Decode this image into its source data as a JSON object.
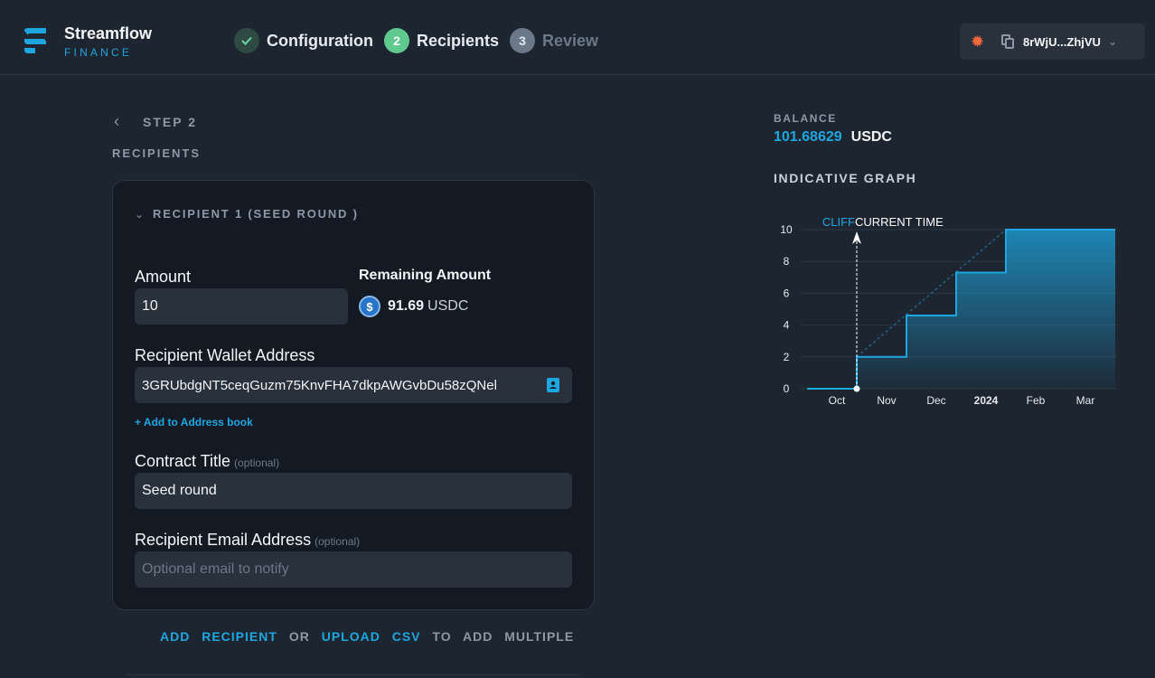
{
  "app": {
    "name": "Streamflow",
    "sub": "FINANCE"
  },
  "steps": [
    {
      "num": "",
      "label": "Configuration",
      "state": "done"
    },
    {
      "num": "2",
      "label": "Recipients",
      "state": "active"
    },
    {
      "num": "3",
      "label": "Review",
      "state": "todo"
    }
  ],
  "wallet": {
    "address": "8rWjU...ZhjVU",
    "icon": "burst-icon",
    "copy_icon": "copy-icon",
    "chevron": "chevron-down-icon"
  },
  "nav": {
    "back_label": "STEP 2",
    "section_title": "RECIPIENTS"
  },
  "recipient": {
    "header": "RECIPIENT 1 (SEED ROUND )",
    "amount_label": "Amount",
    "amount_value": "10",
    "remaining_label": "Remaining Amount",
    "remaining_value": "91.69",
    "remaining_unit": "USDC",
    "coin_glyph": "$",
    "wallet_label": "Recipient Wallet Address",
    "wallet_value": "3GRUbdgNT5ceqGuzm75KnvFHA7dkpAWGvbDu58zQNel",
    "add_address_book": "+ Add to Address book",
    "title_label": "Contract Title",
    "title_optional": "(optional)",
    "title_value": "Seed round",
    "email_label": "Recipient Email Address",
    "email_optional": "(optional)",
    "email_placeholder": "Optional email to notify"
  },
  "footer": {
    "add": "ADD",
    "recipient": "RECIPIENT",
    "or": "OR",
    "upload": "UPLOAD",
    "csv": "CSV",
    "to": "TO",
    "add2": "ADD",
    "multiple": "MULTIPLE"
  },
  "balance": {
    "label": "BALANCE",
    "value": "101.68629",
    "unit": "USDC"
  },
  "colors": {
    "accent": "#1ea6e0",
    "success": "#5fc98f",
    "background": "#1d2530",
    "card": "#131a24",
    "field": "#28313c"
  },
  "chart_data": {
    "type": "area",
    "title": "INDICATIVE GRAPH",
    "x_ticks": [
      "Oct",
      "Nov",
      "Dec",
      "2024",
      "Feb",
      "Mar"
    ],
    "y_ticks": [
      0,
      2,
      4,
      6,
      8,
      10
    ],
    "ylim": [
      0,
      10
    ],
    "grid": true,
    "annotations": [
      "CLIFF",
      "CURRENT TIME"
    ],
    "series": [
      {
        "kind": "step",
        "x": [
          -0.6,
          0.4,
          0.4,
          1.4,
          1.4,
          2.4,
          2.4,
          3.4,
          3.4,
          4.4,
          4.4,
          5.6
        ],
        "y": [
          0,
          0,
          2,
          2,
          4.6,
          4.6,
          7.3,
          7.3,
          10,
          10,
          10,
          10
        ]
      },
      {
        "kind": "linear",
        "x": [
          0.4,
          3.4
        ],
        "y": [
          2,
          10
        ]
      }
    ],
    "cliff_x": 0.4,
    "current_x": 0.4
  }
}
